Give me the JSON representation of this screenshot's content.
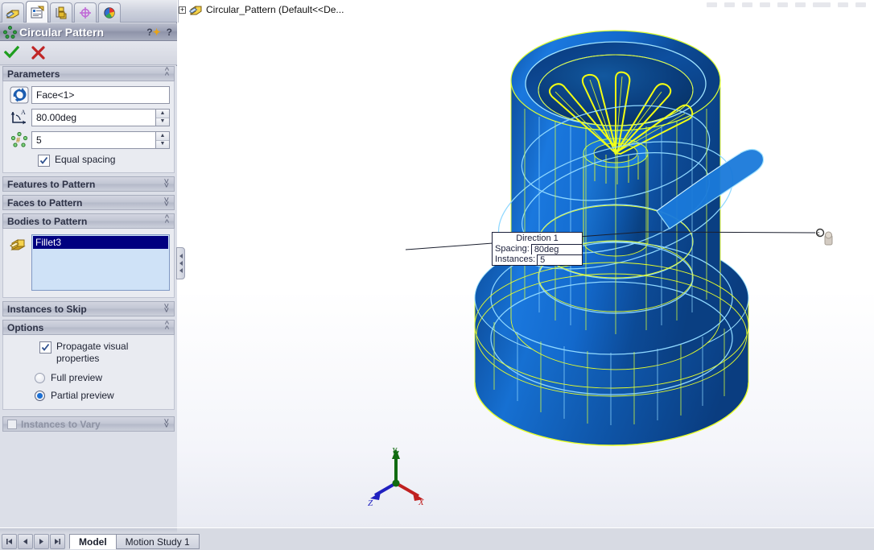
{
  "window": {
    "manager_tabs": [
      {
        "name": "feature-manager-design-tree",
        "selected": false
      },
      {
        "name": "property-manager",
        "selected": true
      },
      {
        "name": "configuration-manager",
        "selected": false
      },
      {
        "name": "dimxpert-manager",
        "selected": false
      },
      {
        "name": "display-manager",
        "selected": false
      }
    ]
  },
  "property_manager": {
    "title": "Circular Pattern",
    "title_buttons": [
      "help-options-icon",
      "help-icon"
    ],
    "ok_label": "ok-check",
    "cancel_label": "cancel-x",
    "groups": {
      "parameters": {
        "title": "Parameters",
        "expanded": true,
        "axis_icon": "rotate-axis-icon",
        "axis_value": "Face<1>",
        "angle_icon": "angle-icon",
        "angle_value": "80.00deg",
        "count_icon": "instance-count-icon",
        "count_value": "5",
        "equal_spacing_label": "Equal spacing",
        "equal_spacing_checked": true
      },
      "features_to_pattern": {
        "title": "Features to Pattern",
        "expanded": false
      },
      "faces_to_pattern": {
        "title": "Faces to Pattern",
        "expanded": false
      },
      "bodies_to_pattern": {
        "title": "Bodies to Pattern",
        "expanded": true,
        "icon": "solid-body-icon",
        "items": [
          "Fillet3"
        ]
      },
      "instances_to_skip": {
        "title": "Instances to Skip",
        "expanded": false
      },
      "options": {
        "title": "Options",
        "expanded": true,
        "propagate_label": "Propagate visual properties",
        "propagate_checked": true,
        "full_preview_label": "Full preview",
        "partial_preview_label": "Partial preview",
        "preview_selected": "Partial preview"
      },
      "instances_to_vary": {
        "title": "Instances to Vary",
        "expanded": false,
        "checkbox_checked": false
      }
    }
  },
  "viewport": {
    "tree_root": {
      "expander": "+",
      "icon": "part-document-icon",
      "label": "Circular_Pattern  (Default<<De..."
    },
    "callout": {
      "title": "Direction 1",
      "spacing_label": "Spacing:",
      "spacing_value": "80deg",
      "instances_label": "Instances:",
      "instances_value": "5"
    },
    "triad": {
      "x_label": "X",
      "y_label": "Y",
      "z_label": "Z",
      "x_color": "#cc2222",
      "y_color": "#128012",
      "z_color": "#2222cc"
    },
    "model": {
      "body_color": "#1163c6",
      "body_shadow_color": "#0b3f84",
      "edge_color": "#9fe3ff",
      "highlight_edge_color": "#eaff16",
      "background_top": "#ffffff",
      "background_bottom": "#e9ebf3"
    }
  },
  "bottom_bar": {
    "nav_buttons": [
      "first-icon",
      "previous-icon",
      "next-icon",
      "last-icon"
    ],
    "tabs": [
      {
        "label": "Model",
        "selected": true
      },
      {
        "label": "Motion Study 1",
        "selected": false
      }
    ]
  }
}
